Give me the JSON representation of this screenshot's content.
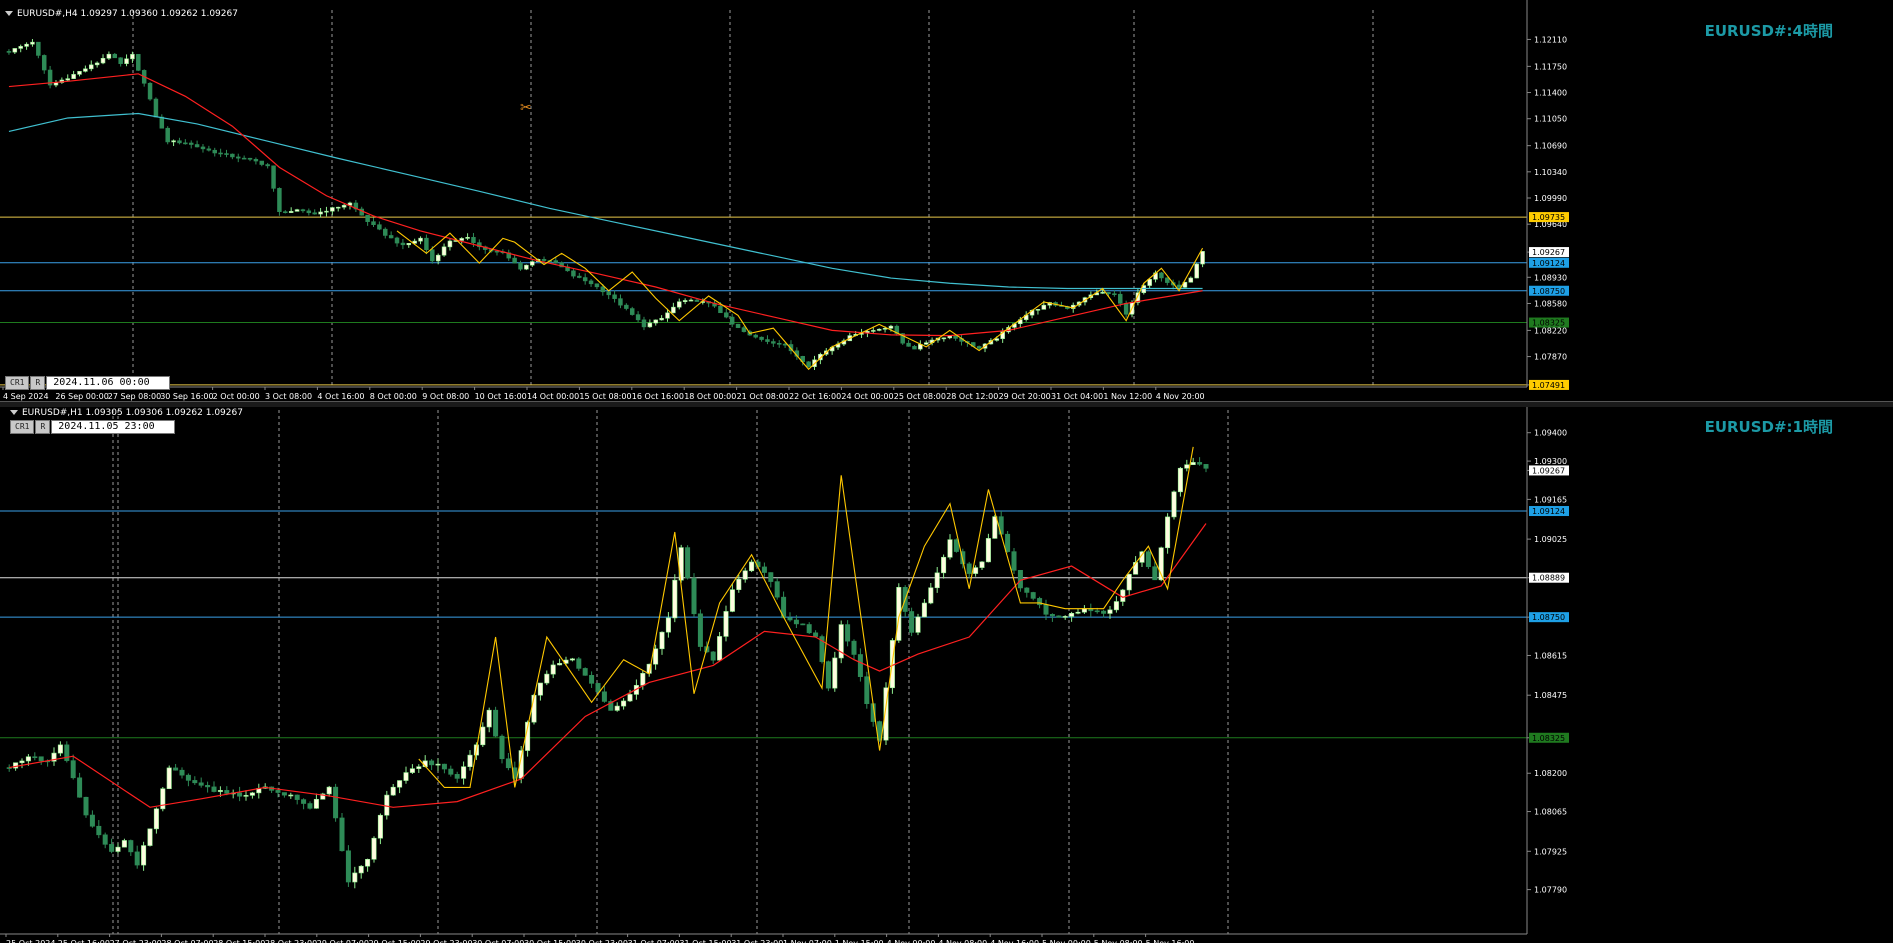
{
  "colors": {
    "background": "#000000",
    "bull_candle": "#90ee90",
    "bull_candle_body": "#fffde0",
    "bear_candle": "#2e8b57",
    "ma_red": "#ff2020",
    "ma_cyan": "#40c0d0",
    "zigzag": "#ffc800",
    "hline_yellow": "#e8c84a",
    "hline_blue": "#3aa0e8",
    "hline_green": "#1e7a1e",
    "hline_white": "#dddddd",
    "vgrid": "#9a9a9a",
    "symbol_label": "#1c9aa6"
  },
  "top_chart": {
    "header": "EURUSD#,H4  1.09297 1.09360 1.09262 1.09267",
    "symbol_label": "EURUSD#:4時間",
    "ctrl_cr1": "CR1",
    "ctrl_r": "R",
    "ctrl_date": "2024.11.06 00:00",
    "chart_data": {
      "type": "candlestick",
      "ylim": [
        1.0749,
        1.1245
      ],
      "y_ticks": [
        "1.12110",
        "1.11750",
        "1.11400",
        "1.11050",
        "1.10690",
        "1.10340",
        "1.09990",
        "1.09640",
        "1.09267",
        "1.08930",
        "1.08580",
        "1.08220",
        "1.07870",
        "1.07491"
      ],
      "x_labels": [
        "4 Sep 2024",
        "26 Sep 00:00",
        "27 Sep 08:00",
        "30 Sep 16:00",
        "2 Oct 00:00",
        "3 Oct 08:00",
        "4 Oct 16:00",
        "8 Oct 00:00",
        "9 Oct 08:00",
        "10 Oct 16:00",
        "14 Oct 00:00",
        "15 Oct 08:00",
        "16 Oct 16:00",
        "18 Oct 00:00",
        "21 Oct 08:00",
        "22 Oct 16:00",
        "24 Oct 00:00",
        "25 Oct 08:00",
        "28 Oct 12:00",
        "29 Oct 20:00",
        "31 Oct 04:00",
        "1 Nov 12:00",
        "4 Nov 20:00"
      ],
      "price_tags": [
        {
          "label": "1.09735",
          "value": 1.09735,
          "kind": "yellow"
        },
        {
          "label": "1.09267",
          "value": 1.09267,
          "kind": "current"
        },
        {
          "label": "1.09124",
          "value": 1.09124,
          "kind": "blue"
        },
        {
          "label": "1.08750",
          "value": 1.0875,
          "kind": "blue"
        },
        {
          "label": "1.08325",
          "value": 1.08325,
          "kind": "green"
        },
        {
          "label": "1.07491",
          "value": 1.07491,
          "kind": "yellow"
        }
      ],
      "hlines": [
        {
          "value": 1.09735,
          "kind": "yellow"
        },
        {
          "value": 1.09124,
          "kind": "blue"
        },
        {
          "value": 1.0875,
          "kind": "blue"
        },
        {
          "value": 1.08325,
          "kind": "green"
        },
        {
          "value": 1.07491,
          "kind": "yellow"
        }
      ],
      "close_path": [
        [
          0,
          1.1195
        ],
        [
          4,
          1.1208
        ],
        [
          7,
          1.115
        ],
        [
          10,
          1.116
        ],
        [
          13,
          1.1172
        ],
        [
          15,
          1.118
        ],
        [
          17,
          1.1192
        ],
        [
          19,
          1.1178
        ],
        [
          21,
          1.119
        ],
        [
          23,
          1.1152
        ],
        [
          25,
          1.1108
        ],
        [
          27,
          1.1075
        ],
        [
          30,
          1.1073
        ],
        [
          33,
          1.1065
        ],
        [
          36,
          1.1058
        ],
        [
          39,
          1.1053
        ],
        [
          42,
          1.1048
        ],
        [
          44,
          1.1042
        ],
        [
          46,
          1.098
        ],
        [
          49,
          1.0982
        ],
        [
          52,
          1.0978
        ],
        [
          55,
          1.0985
        ],
        [
          58,
          1.0992
        ],
        [
          61,
          1.0968
        ],
        [
          64,
          1.095
        ],
        [
          67,
          1.0935
        ],
        [
          70,
          1.0945
        ],
        [
          72,
          1.0915
        ],
        [
          75,
          1.0942
        ],
        [
          78,
          1.0945
        ],
        [
          81,
          1.093
        ],
        [
          84,
          1.0925
        ],
        [
          87,
          1.0905
        ],
        [
          90,
          1.0918
        ],
        [
          93,
          1.0912
        ],
        [
          96,
          1.0895
        ],
        [
          99,
          1.0885
        ],
        [
          102,
          1.087
        ],
        [
          105,
          1.085
        ],
        [
          108,
          1.0828
        ],
        [
          111,
          1.0838
        ],
        [
          114,
          1.086
        ],
        [
          117,
          1.0862
        ],
        [
          120,
          1.0855
        ],
        [
          123,
          1.083
        ],
        [
          126,
          1.0815
        ],
        [
          129,
          1.0808
        ],
        [
          132,
          1.0802
        ],
        [
          134,
          1.0788
        ],
        [
          136,
          1.0775
        ],
        [
          138,
          1.079
        ],
        [
          141,
          1.0805
        ],
        [
          144,
          1.0818
        ],
        [
          147,
          1.0822
        ],
        [
          150,
          1.0828
        ],
        [
          152,
          1.0805
        ],
        [
          154,
          1.0798
        ],
        [
          157,
          1.081
        ],
        [
          160,
          1.0815
        ],
        [
          163,
          1.0805
        ],
        [
          165,
          1.0798
        ],
        [
          168,
          1.0812
        ],
        [
          171,
          1.0832
        ],
        [
          174,
          1.0848
        ],
        [
          177,
          1.0858
        ],
        [
          180,
          1.0852
        ],
        [
          183,
          1.0865
        ],
        [
          185,
          1.0873
        ],
        [
          188,
          1.087
        ],
        [
          190,
          1.0845
        ],
        [
          192,
          1.0872
        ],
        [
          195,
          1.0898
        ],
        [
          197,
          1.0885
        ],
        [
          199,
          1.088
        ],
        [
          201,
          1.0892
        ],
        [
          203,
          1.0927
        ]
      ],
      "ma_red": [
        [
          0,
          1.1148
        ],
        [
          10,
          1.1155
        ],
        [
          22,
          1.1165
        ],
        [
          30,
          1.1135
        ],
        [
          38,
          1.1095
        ],
        [
          46,
          1.104
        ],
        [
          54,
          1.1002
        ],
        [
          62,
          1.0975
        ],
        [
          70,
          1.0955
        ],
        [
          80,
          1.0935
        ],
        [
          90,
          1.0915
        ],
        [
          100,
          1.0898
        ],
        [
          110,
          1.088
        ],
        [
          120,
          1.0858
        ],
        [
          130,
          1.084
        ],
        [
          140,
          1.0822
        ],
        [
          150,
          1.0816
        ],
        [
          160,
          1.0815
        ],
        [
          170,
          1.0822
        ],
        [
          180,
          1.084
        ],
        [
          190,
          1.0858
        ],
        [
          203,
          1.0875
        ]
      ],
      "ma_cyan": [
        [
          0,
          1.1088
        ],
        [
          10,
          1.1106
        ],
        [
          22,
          1.1112
        ],
        [
          32,
          1.1098
        ],
        [
          44,
          1.1075
        ],
        [
          56,
          1.1052
        ],
        [
          68,
          1.103
        ],
        [
          80,
          1.1008
        ],
        [
          92,
          1.0985
        ],
        [
          104,
          1.0965
        ],
        [
          116,
          1.0945
        ],
        [
          128,
          1.0925
        ],
        [
          140,
          1.0905
        ],
        [
          150,
          1.0892
        ],
        [
          160,
          1.0885
        ],
        [
          170,
          1.088
        ],
        [
          180,
          1.0878
        ],
        [
          190,
          1.0878
        ],
        [
          203,
          1.0878
        ]
      ],
      "zigzag": [
        [
          66,
          1.0955
        ],
        [
          71,
          1.0925
        ],
        [
          75,
          1.0952
        ],
        [
          80,
          1.0912
        ],
        [
          84,
          1.0945
        ],
        [
          86,
          1.094
        ],
        [
          91,
          1.091
        ],
        [
          94,
          1.0925
        ],
        [
          98,
          1.0905
        ],
        [
          102,
          1.0875
        ],
        [
          106,
          1.09
        ],
        [
          110,
          1.0865
        ],
        [
          114,
          1.0835
        ],
        [
          119,
          1.0868
        ],
        [
          124,
          1.0842
        ],
        [
          126,
          1.0818
        ],
        [
          130,
          1.0825
        ],
        [
          136,
          1.077
        ],
        [
          140,
          1.08
        ],
        [
          148,
          1.083
        ],
        [
          152,
          1.0815
        ],
        [
          156,
          1.08
        ],
        [
          160,
          1.0822
        ],
        [
          165,
          1.0795
        ],
        [
          170,
          1.0825
        ],
        [
          176,
          1.086
        ],
        [
          181,
          1.0852
        ],
        [
          186,
          1.0878
        ],
        [
          190,
          1.0835
        ],
        [
          193,
          1.0885
        ],
        [
          196,
          1.0905
        ],
        [
          199,
          1.0875
        ],
        [
          203,
          1.0932
        ]
      ]
    }
  },
  "bottom_chart": {
    "header": "EURUSD#,H1  1.09305 1.09306 1.09262 1.09267",
    "symbol_label": "EURUSD#:1時間",
    "ctrl_cr1": "CR1",
    "ctrl_r": "R",
    "ctrl_date": "2024.11.05 23:00",
    "chart_data": {
      "type": "candlestick",
      "ylim": [
        1.0763,
        1.0948
      ],
      "y_ticks": [
        "1.09400",
        "1.09300",
        "1.09267",
        "1.09165",
        "1.09025",
        "1.08889",
        "1.08750",
        "1.08615",
        "1.08475",
        "1.08325",
        "1.08200",
        "1.08065",
        "1.07925",
        "1.07790"
      ],
      "x_labels": [
        "25 Oct 2024",
        "25 Oct 16:00",
        "27 Oct 23:00",
        "28 Oct 07:00",
        "28 Oct 15:00",
        "28 Oct 23:00",
        "29 Oct 07:00",
        "29 Oct 15:00",
        "29 Oct 23:00",
        "30 Oct 07:00",
        "30 Oct 15:00",
        "30 Oct 23:00",
        "31 Oct 07:00",
        "31 Oct 15:00",
        "31 Oct 23:00",
        "1 Nov 07:00",
        "1 Nov 15:00",
        "4 Nov 00:00",
        "4 Nov 08:00",
        "4 Nov 16:00",
        "5 Nov 00:00",
        "5 Nov 08:00",
        "5 Nov 16:00"
      ],
      "price_tags": [
        {
          "label": "1.09267",
          "value": 1.09267,
          "kind": "current"
        },
        {
          "label": "1.09124",
          "value": 1.09124,
          "kind": "blue"
        },
        {
          "label": "1.08889",
          "value": 1.08889,
          "kind": "white"
        },
        {
          "label": "1.08750",
          "value": 1.0875,
          "kind": "blue"
        },
        {
          "label": "1.08325",
          "value": 1.08325,
          "kind": "green"
        }
      ],
      "hlines": [
        {
          "value": 1.09124,
          "kind": "blue"
        },
        {
          "value": 1.08889,
          "kind": "white"
        },
        {
          "value": 1.0875,
          "kind": "blue"
        },
        {
          "value": 1.08325,
          "kind": "green"
        }
      ],
      "close_path": [
        [
          0,
          1.0822
        ],
        [
          3,
          1.0826
        ],
        [
          6,
          1.0824
        ],
        [
          8,
          1.083
        ],
        [
          10,
          1.0818
        ],
        [
          12,
          1.0805
        ],
        [
          14,
          1.0798
        ],
        [
          16,
          1.0792
        ],
        [
          18,
          1.0796
        ],
        [
          20,
          1.0788
        ],
        [
          22,
          1.08
        ],
        [
          25,
          1.0822
        ],
        [
          28,
          1.0818
        ],
        [
          32,
          1.0814
        ],
        [
          36,
          1.0812
        ],
        [
          40,
          1.0815
        ],
        [
          44,
          1.0812
        ],
        [
          47,
          1.0808
        ],
        [
          50,
          1.0815
        ],
        [
          53,
          1.0782
        ],
        [
          56,
          1.079
        ],
        [
          59,
          1.0812
        ],
        [
          62,
          1.082
        ],
        [
          65,
          1.0824
        ],
        [
          68,
          1.0822
        ],
        [
          70,
          1.0818
        ],
        [
          73,
          1.083
        ],
        [
          75,
          1.0842
        ],
        [
          77,
          1.0825
        ],
        [
          79,
          1.0818
        ],
        [
          82,
          1.0848
        ],
        [
          85,
          1.0858
        ],
        [
          88,
          1.086
        ],
        [
          91,
          1.0852
        ],
        [
          94,
          1.0842
        ],
        [
          97,
          1.0848
        ],
        [
          100,
          1.0858
        ],
        [
          103,
          1.0875
        ],
        [
          105,
          1.09
        ],
        [
          108,
          1.0865
        ],
        [
          110,
          1.086
        ],
        [
          113,
          1.0885
        ],
        [
          116,
          1.0895
        ],
        [
          119,
          1.0888
        ],
        [
          121,
          1.0875
        ],
        [
          124,
          1.0872
        ],
        [
          126,
          1.0868
        ],
        [
          128,
          1.085
        ],
        [
          130,
          1.0872
        ],
        [
          132,
          1.0862
        ],
        [
          134,
          1.0845
        ],
        [
          136,
          1.0832
        ],
        [
          139,
          1.0885
        ],
        [
          141,
          1.087
        ],
        [
          144,
          1.0885
        ],
        [
          147,
          1.0902
        ],
        [
          150,
          1.089
        ],
        [
          152,
          1.0895
        ],
        [
          154,
          1.091
        ],
        [
          156,
          1.0898
        ],
        [
          158,
          1.0885
        ],
        [
          160,
          1.0882
        ],
        [
          162,
          1.0876
        ],
        [
          165,
          1.0875
        ],
        [
          168,
          1.0878
        ],
        [
          171,
          1.0876
        ],
        [
          173,
          1.088
        ],
        [
          175,
          1.089
        ],
        [
          177,
          1.0898
        ],
        [
          179,
          1.0888
        ],
        [
          181,
          1.091
        ],
        [
          183,
          1.0928
        ],
        [
          185,
          1.093
        ],
        [
          187,
          1.0927
        ]
      ],
      "ma_red": [
        [
          0,
          1.0822
        ],
        [
          10,
          1.0826
        ],
        [
          22,
          1.0808
        ],
        [
          30,
          1.0811
        ],
        [
          40,
          1.0815
        ],
        [
          50,
          1.0812
        ],
        [
          60,
          1.0808
        ],
        [
          70,
          1.081
        ],
        [
          80,
          1.0818
        ],
        [
          90,
          1.084
        ],
        [
          100,
          1.0852
        ],
        [
          110,
          1.0858
        ],
        [
          118,
          1.087
        ],
        [
          126,
          1.0868
        ],
        [
          132,
          1.086
        ],
        [
          136,
          1.0856
        ],
        [
          142,
          1.0862
        ],
        [
          150,
          1.0868
        ],
        [
          158,
          1.0888
        ],
        [
          166,
          1.0893
        ],
        [
          174,
          1.0882
        ],
        [
          180,
          1.0886
        ],
        [
          187,
          1.0908
        ]
      ],
      "zigzag": [
        [
          64,
          1.0825
        ],
        [
          68,
          1.0815
        ],
        [
          72,
          1.0815
        ],
        [
          76,
          1.0868
        ],
        [
          79,
          1.0815
        ],
        [
          84,
          1.0868
        ],
        [
          91,
          1.0845
        ],
        [
          96,
          1.086
        ],
        [
          100,
          1.0855
        ],
        [
          104,
          1.0905
        ],
        [
          107,
          1.0848
        ],
        [
          111,
          1.088
        ],
        [
          116,
          1.0897
        ],
        [
          121,
          1.0875
        ],
        [
          127,
          1.085
        ],
        [
          130,
          1.0925
        ],
        [
          136,
          1.0828
        ],
        [
          139,
          1.0875
        ],
        [
          143,
          1.09
        ],
        [
          147,
          1.0915
        ],
        [
          150,
          1.0885
        ],
        [
          153,
          1.092
        ],
        [
          158,
          1.088
        ],
        [
          161,
          1.088
        ],
        [
          165,
          1.0878
        ],
        [
          171,
          1.0878
        ],
        [
          174,
          1.0888
        ],
        [
          178,
          1.09
        ],
        [
          181,
          1.0885
        ],
        [
          185,
          1.0935
        ]
      ]
    }
  }
}
